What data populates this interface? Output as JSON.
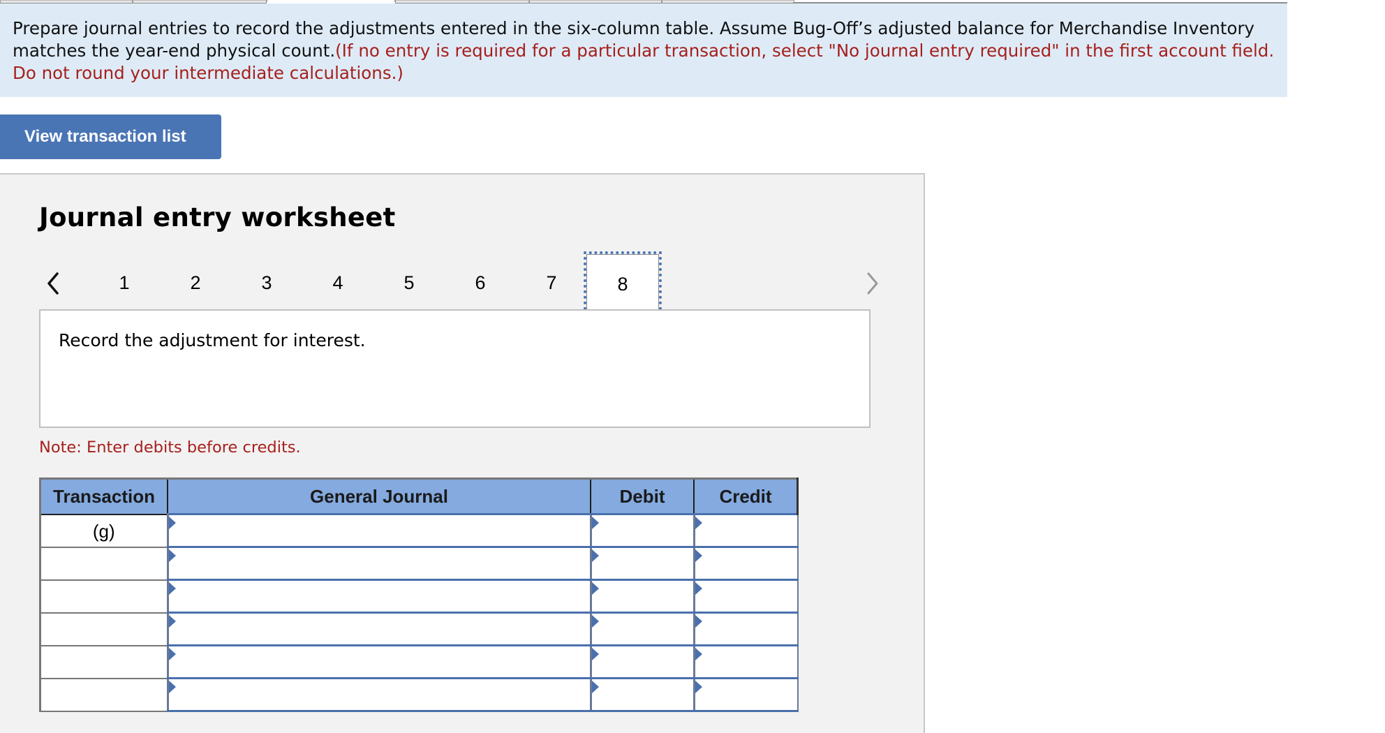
{
  "instructions": {
    "main_text": "Prepare journal entries to record the adjustments entered in the six-column table. Assume Bug-Off’s adjusted balance for Merchandise Inventory matches the year-end physical count.",
    "note_text": "(If no entry is required for a particular transaction, select \"No journal entry required\" in the first account field. Do not round your intermediate calculations.)"
  },
  "view_transaction_button": "View transaction list",
  "worksheet": {
    "title": "Journal entry worksheet",
    "pager": {
      "prev_icon": "chevron-left-icon",
      "next_icon": "chevron-right-icon",
      "pages": [
        "1",
        "2",
        "3",
        "4",
        "5",
        "6",
        "7",
        "8"
      ],
      "active_page": "8"
    },
    "question": "Record the adjustment for interest.",
    "note": "Note: Enter debits before credits.",
    "table": {
      "headers": {
        "transaction": "Transaction",
        "general_journal": "General Journal",
        "debit": "Debit",
        "credit": "Credit"
      },
      "rows": [
        {
          "transaction": "(g)",
          "account": "",
          "debit": "",
          "credit": ""
        },
        {
          "transaction": "",
          "account": "",
          "debit": "",
          "credit": ""
        },
        {
          "transaction": "",
          "account": "",
          "debit": "",
          "credit": ""
        },
        {
          "transaction": "",
          "account": "",
          "debit": "",
          "credit": ""
        },
        {
          "transaction": "",
          "account": "",
          "debit": "",
          "credit": ""
        },
        {
          "transaction": "",
          "account": "",
          "debit": "",
          "credit": ""
        }
      ]
    }
  },
  "colors": {
    "banner_bg": "#deebf7",
    "instruction_red": "#a6201c",
    "button_blue": "#4a75b5",
    "table_header_blue": "#84aadf",
    "panel_bg": "#f2f2f2"
  }
}
